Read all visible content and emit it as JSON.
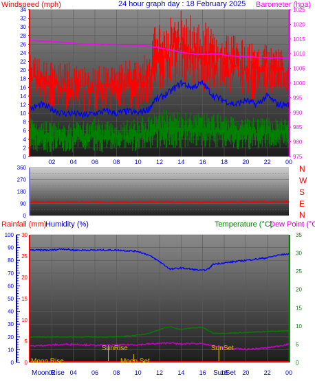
{
  "header": {
    "wind_label": "Windspeed (mph)",
    "title": "24 hour graph day : 18 February 2025",
    "baro_label": "Barometer (hpa)"
  },
  "middle": {
    "compass": [
      "N",
      "W",
      "S",
      "E",
      "N"
    ]
  },
  "lower": {
    "rain_label": "Rainfall (mm)",
    "humidity_label": "Humidity (%)",
    "temp_label": "Temperature (°C)",
    "dew_label": "Dew Point (°C)",
    "sunrise": "SunRise",
    "sunset": "SunSet",
    "moonrise": "Moon Rise",
    "moonset": "Moon Set"
  },
  "colors": {
    "wind": "#ff0000",
    "gust_avg": "#0000ff",
    "wind_low": "#008000",
    "baro": "#ff00ff",
    "direction": "#ff0000",
    "humidity": "#0000ff",
    "temperature": "#008000",
    "dewpoint": "#cc00cc",
    "rain": "#ff0000",
    "sun": "#e0c000"
  },
  "chart_data": [
    {
      "type": "line",
      "title": "24 hour graph day : 18 February 2025",
      "x_ticks": [
        "02",
        "04",
        "06",
        "08",
        "10",
        "12",
        "14",
        "16",
        "18",
        "20",
        "22",
        "00"
      ],
      "ylabel": "Windspeed (mph)",
      "y_ticks": [
        0,
        2,
        4,
        6,
        8,
        10,
        12,
        14,
        16,
        18,
        20,
        22,
        24,
        26,
        28,
        30,
        32,
        34
      ],
      "ylim": [
        0,
        34
      ],
      "y2label": "Barometer (hpa)",
      "y2_ticks": [
        975,
        980,
        985,
        990,
        995,
        1000,
        1005,
        1010,
        1015,
        1020,
        1025
      ],
      "y2lim": [
        975,
        1025
      ],
      "series": [
        {
          "role": "gust",
          "x": [
            0,
            2,
            4,
            6,
            8,
            10,
            11,
            11.5,
            12,
            13,
            14,
            15,
            16,
            17,
            18,
            19,
            20,
            21,
            22,
            23,
            24
          ],
          "low": [
            12,
            11,
            10,
            10,
            11,
            11,
            12,
            14,
            15,
            16,
            18,
            16,
            15,
            15,
            14,
            14,
            13,
            13,
            14,
            15,
            14
          ],
          "high": [
            24,
            22,
            22,
            21,
            22,
            23,
            24,
            30,
            32,
            33,
            34,
            33,
            32,
            30,
            29,
            28,
            27,
            26,
            27,
            26,
            24
          ]
        },
        {
          "role": "average",
          "x": [
            0,
            1,
            2,
            3,
            4,
            5,
            6,
            7,
            8,
            9,
            10,
            11,
            11.5,
            12,
            13,
            14,
            15,
            16,
            17,
            18,
            19,
            20,
            21,
            22,
            23,
            24
          ],
          "values": [
            11,
            12,
            11,
            10,
            10,
            9.5,
            10,
            10.5,
            10,
            10.5,
            10,
            11,
            13,
            13.5,
            15,
            17,
            16,
            17,
            14,
            13,
            12,
            13,
            12,
            14,
            12,
            12
          ]
        },
        {
          "role": "low",
          "x": [
            0,
            2,
            4,
            6,
            8,
            10,
            11,
            11.5,
            12,
            14,
            16,
            18,
            20,
            22,
            24
          ],
          "low": [
            1,
            1,
            1,
            1,
            1,
            1,
            1.5,
            2,
            2,
            2,
            2,
            2,
            1.5,
            2,
            2
          ],
          "high": [
            10,
            8,
            8,
            9,
            8,
            9,
            10,
            10,
            11,
            11,
            10,
            10,
            9,
            9,
            9
          ]
        },
        {
          "role": "barometer",
          "axis": "y2",
          "x": [
            0,
            2,
            4,
            6,
            8,
            10,
            11,
            12,
            13,
            14,
            15,
            16,
            17,
            18,
            19,
            20,
            21,
            22,
            23,
            24
          ],
          "values": [
            1014.5,
            1014.2,
            1013.5,
            1013.2,
            1013,
            1012.8,
            1012.5,
            1012,
            1011.2,
            1010.5,
            1010,
            1009.8,
            1010,
            1009.6,
            1009.2,
            1009,
            1008.8,
            1008.6,
            1008.5,
            1008.5
          ]
        }
      ]
    },
    {
      "type": "line",
      "ylabel": "",
      "y_ticks": [
        0,
        90,
        180,
        270,
        360
      ],
      "ylim": [
        0,
        360
      ],
      "series": [
        {
          "role": "direction",
          "x": [
            0,
            2,
            4,
            6,
            8,
            10,
            12,
            14,
            16,
            18,
            20,
            22,
            24
          ],
          "values": [
            102,
            100,
            101,
            100,
            99,
            101,
            104,
            100,
            100,
            99,
            101,
            102,
            103
          ]
        }
      ]
    },
    {
      "type": "line",
      "x_ticks": [
        "02",
        "04",
        "06",
        "08",
        "10",
        "12",
        "14",
        "16",
        "18",
        "20",
        "22",
        "00"
      ],
      "rain_ticks": [
        0,
        5,
        10,
        15,
        20,
        25,
        30
      ],
      "humidity_ticks": [
        0,
        10,
        20,
        30,
        40,
        50,
        60,
        70,
        80,
        90,
        100
      ],
      "temp_ticks": [
        0,
        5,
        10,
        15,
        20,
        25,
        30,
        35
      ],
      "ylim_rain": [
        0,
        30
      ],
      "ylim_humidity": [
        0,
        100
      ],
      "ylim_temp": [
        0,
        35
      ],
      "series": [
        {
          "role": "humidity",
          "axis": "humidity",
          "x": [
            0,
            1,
            2,
            3,
            4,
            6,
            8,
            10,
            11,
            12,
            12.5,
            13,
            14,
            15,
            16,
            16.5,
            17,
            18,
            19,
            20,
            21,
            22,
            23,
            24
          ],
          "values": [
            88,
            88,
            88,
            89,
            88,
            88,
            88,
            87,
            84,
            79,
            76,
            73,
            74,
            73,
            72,
            73,
            77,
            78,
            79,
            80,
            81,
            82,
            84,
            85
          ]
        },
        {
          "role": "temperature",
          "axis": "temp",
          "x": [
            0,
            2,
            4,
            6,
            8,
            10,
            11,
            12,
            12.5,
            13,
            14,
            15,
            16,
            17,
            18,
            20,
            22,
            24
          ],
          "values": [
            7,
            7,
            7,
            7,
            7,
            7.5,
            8,
            9,
            9.5,
            9.8,
            9,
            9.5,
            9.6,
            8,
            8,
            8.2,
            8.5,
            8.7
          ]
        },
        {
          "role": "dewpoint",
          "axis": "temp",
          "x": [
            0,
            2,
            4,
            6,
            8,
            10,
            12,
            13,
            14,
            15,
            16,
            17,
            18,
            19,
            20,
            22,
            23,
            24
          ],
          "values": [
            4.5,
            4.8,
            5,
            4.7,
            4.8,
            4.9,
            5.2,
            5.4,
            5,
            5.3,
            5.1,
            4.5,
            4,
            3.8,
            3.6,
            4,
            4.5,
            5
          ]
        },
        {
          "role": "rainfall",
          "axis": "rain",
          "x": [
            0,
            24
          ],
          "values": [
            0,
            0
          ]
        }
      ]
    }
  ]
}
